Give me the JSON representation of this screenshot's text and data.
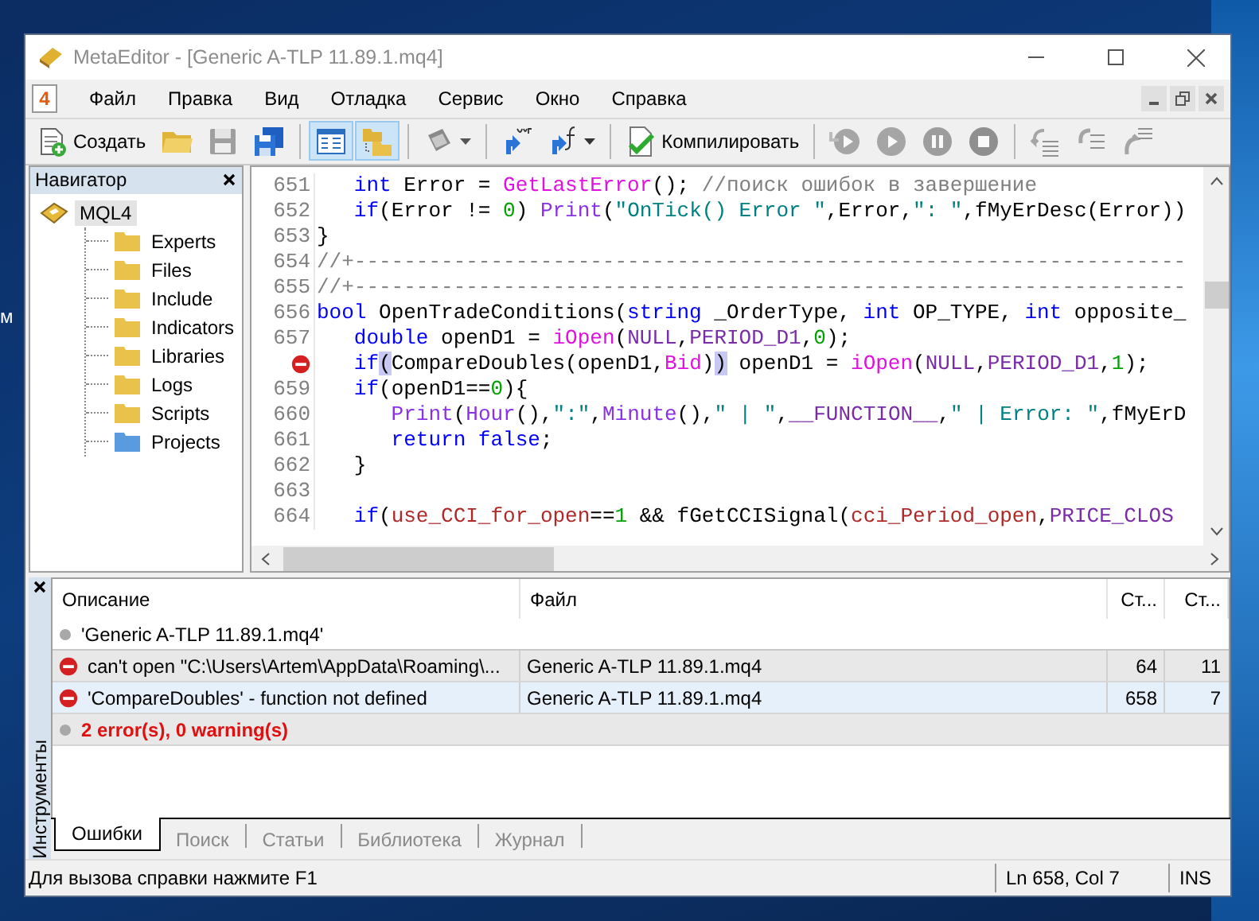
{
  "desktop": {
    "icon_label_fragment": "м"
  },
  "window": {
    "title": "MetaEditor - [Generic A-TLP 11.89.1.mq4]"
  },
  "menu": {
    "document_badge": "4",
    "items": [
      "Файл",
      "Правка",
      "Вид",
      "Отладка",
      "Сервис",
      "Окно",
      "Справка"
    ]
  },
  "toolbar": [
    {
      "label": "Создать",
      "on": false,
      "disabled": false
    },
    {
      "on": false,
      "disabled": false
    },
    {
      "on": false,
      "disabled": true
    },
    {
      "on": false,
      "disabled": false
    },
    {
      "on": true,
      "disabled": false
    },
    {
      "on": true,
      "disabled": false
    },
    {
      "on": false,
      "disabled": false
    },
    {
      "on": false,
      "disabled": false
    },
    {
      "on": false,
      "disabled": false
    },
    {
      "label": "Компилировать",
      "on": false,
      "disabled": false
    },
    {
      "on": false,
      "disabled": true
    },
    {
      "on": false,
      "disabled": true
    },
    {
      "on": false,
      "disabled": true
    },
    {
      "on": false,
      "disabled": true
    },
    {
      "on": false,
      "disabled": true
    },
    {
      "on": false,
      "disabled": true
    },
    {
      "on": false,
      "disabled": true
    }
  ],
  "navigator": {
    "title": "Навигатор",
    "root": {
      "label": "MQL4",
      "selected": true,
      "children": [
        {
          "label": "Experts",
          "selected": false,
          "color": "#e8c24a"
        },
        {
          "label": "Files",
          "selected": false,
          "color": "#e8c24a"
        },
        {
          "label": "Include",
          "selected": false,
          "color": "#e8c24a"
        },
        {
          "label": "Indicators",
          "selected": false,
          "color": "#e8c24a"
        },
        {
          "label": "Libraries",
          "selected": false,
          "color": "#e8c24a"
        },
        {
          "label": "Logs",
          "selected": false,
          "color": "#e8c24a"
        },
        {
          "label": "Scripts",
          "selected": false,
          "color": "#e8c24a"
        },
        {
          "label": "Projects",
          "selected": false,
          "color": "#5a9be0"
        }
      ]
    }
  },
  "editor": {
    "lines": [
      {
        "number": "651",
        "tokens": [
          {
            "kind": "keyword",
            "text": "   int"
          },
          {
            "kind": "plain",
            "text": " Error = "
          },
          {
            "kind": "function",
            "text": "GetLastError"
          },
          {
            "kind": "plain",
            "text": "(); "
          },
          {
            "kind": "comment",
            "text": "//поиск ошибок в завершение"
          }
        ]
      },
      {
        "number": "652",
        "tokens": [
          {
            "kind": "keyword",
            "text": "   if"
          },
          {
            "kind": "plain",
            "text": "(Error != "
          },
          {
            "kind": "number",
            "text": "0"
          },
          {
            "kind": "plain",
            "text": ") "
          },
          {
            "kind": "builtin",
            "text": "Print"
          },
          {
            "kind": "plain",
            "text": "("
          },
          {
            "kind": "string",
            "text": "\"OnTick() Error \""
          },
          {
            "kind": "plain",
            "text": ",Error,"
          },
          {
            "kind": "string",
            "text": "\": \""
          },
          {
            "kind": "plain",
            "text": ",fMyErDesc(Error))"
          }
        ]
      },
      {
        "number": "653",
        "tokens": [
          {
            "kind": "plain",
            "text": "}"
          }
        ]
      },
      {
        "number": "654",
        "tokens": [
          {
            "kind": "comment",
            "text": "//+-------------------------------------------------------------------"
          }
        ]
      },
      {
        "number": "655",
        "tokens": [
          {
            "kind": "comment",
            "text": "//+-------------------------------------------------------------------"
          }
        ]
      },
      {
        "number": "656",
        "tokens": [
          {
            "kind": "keyword",
            "text": "bool"
          },
          {
            "kind": "plain",
            "text": " OpenTradeConditions("
          },
          {
            "kind": "keyword",
            "text": "string"
          },
          {
            "kind": "plain",
            "text": " _OrderType, "
          },
          {
            "kind": "keyword",
            "text": "int"
          },
          {
            "kind": "plain",
            "text": " OP_TYPE, "
          },
          {
            "kind": "keyword",
            "text": "int"
          },
          {
            "kind": "plain",
            "text": " opposite_"
          }
        ]
      },
      {
        "number": "657",
        "tokens": [
          {
            "kind": "keyword",
            "text": "   double"
          },
          {
            "kind": "plain",
            "text": " openD1 = "
          },
          {
            "kind": "function",
            "text": "iOpen"
          },
          {
            "kind": "plain",
            "text": "("
          },
          {
            "kind": "constant",
            "text": "NULL"
          },
          {
            "kind": "plain",
            "text": ","
          },
          {
            "kind": "constant",
            "text": "PERIOD_D1"
          },
          {
            "kind": "plain",
            "text": ","
          },
          {
            "kind": "number",
            "text": "0"
          },
          {
            "kind": "plain",
            "text": ");"
          }
        ]
      },
      {
        "kind": "error",
        "tokens": [
          {
            "kind": "keyword",
            "text": "   if"
          },
          {
            "kind": "bracket",
            "text": "("
          },
          {
            "kind": "plain",
            "text": "CompareDoubles(openD1,"
          },
          {
            "kind": "function",
            "text": "Bid"
          },
          {
            "kind": "plain",
            "text": ")"
          },
          {
            "kind": "bracket",
            "text": ")"
          },
          {
            "kind": "plain",
            "text": " openD1 = "
          },
          {
            "kind": "function",
            "text": "iOpen"
          },
          {
            "kind": "plain",
            "text": "("
          },
          {
            "kind": "constant",
            "text": "NULL"
          },
          {
            "kind": "plain",
            "text": ","
          },
          {
            "kind": "constant",
            "text": "PERIOD_D1"
          },
          {
            "kind": "plain",
            "text": ","
          },
          {
            "kind": "number",
            "text": "1"
          },
          {
            "kind": "plain",
            "text": ");"
          }
        ]
      },
      {
        "number": "659",
        "tokens": [
          {
            "kind": "keyword",
            "text": "   if"
          },
          {
            "kind": "plain",
            "text": "(openD1=="
          },
          {
            "kind": "number",
            "text": "0"
          },
          {
            "kind": "plain",
            "text": "){"
          }
        ]
      },
      {
        "number": "660",
        "tokens": [
          {
            "kind": "builtin",
            "text": "      Print"
          },
          {
            "kind": "plain",
            "text": "("
          },
          {
            "kind": "builtin",
            "text": "Hour"
          },
          {
            "kind": "plain",
            "text": "(),"
          },
          {
            "kind": "string",
            "text": "\":\""
          },
          {
            "kind": "plain",
            "text": ","
          },
          {
            "kind": "builtin",
            "text": "Minute"
          },
          {
            "kind": "plain",
            "text": "(),"
          },
          {
            "kind": "string",
            "text": "\" | \""
          },
          {
            "kind": "plain",
            "text": ","
          },
          {
            "kind": "constant",
            "text": "__FUNCTION__"
          },
          {
            "kind": "plain",
            "text": ","
          },
          {
            "kind": "string",
            "text": "\" | Error: \""
          },
          {
            "kind": "plain",
            "text": ",fMyErD"
          }
        ]
      },
      {
        "number": "661",
        "tokens": [
          {
            "kind": "keyword",
            "text": "      return"
          },
          {
            "kind": "keyword",
            "text": " false"
          },
          {
            "kind": "plain",
            "text": ";"
          }
        ]
      },
      {
        "number": "662",
        "tokens": [
          {
            "kind": "plain",
            "text": "   }"
          }
        ]
      },
      {
        "number": "663"
      },
      {
        "number": "664",
        "tokens": [
          {
            "kind": "keyword",
            "text": "   if"
          },
          {
            "kind": "plain",
            "text": "("
          },
          {
            "kind": "input",
            "text": "use_CCI_for_open"
          },
          {
            "kind": "plain",
            "text": "=="
          },
          {
            "kind": "number",
            "text": "1"
          },
          {
            "kind": "plain",
            "text": " && fGetCCISignal("
          },
          {
            "kind": "input",
            "text": "cci_Period_open"
          },
          {
            "kind": "plain",
            "text": ","
          },
          {
            "kind": "constant",
            "text": "PRICE_CLOS"
          }
        ]
      }
    ]
  },
  "toolbox": {
    "title": "Инструменты",
    "columns": [
      "Описание",
      "Файл",
      "Ст...",
      "Ст..."
    ],
    "rows": [
      {
        "kind": "info",
        "description": "'Generic A-TLP 11.89.1.mq4'",
        "selected": false
      },
      {
        "kind": "error",
        "description": "can't open \"C:\\Users\\Artem\\AppData\\Roaming\\...",
        "file": "Generic A-TLP 11.89.1.mq4",
        "line": "64",
        "column": "11",
        "selected": false
      },
      {
        "kind": "error",
        "description": "'CompareDoubles' - function not defined",
        "file": "Generic A-TLP 11.89.1.mq4",
        "line": "658",
        "column": "7",
        "selected": true
      },
      {
        "kind": "summary",
        "description": "2 error(s), 0 warning(s)",
        "selected": false
      }
    ],
    "tabs": [
      {
        "label": "Ошибки",
        "selected": true
      },
      {
        "label": "Поиск",
        "selected": false
      },
      {
        "label": "Статьи",
        "selected": false
      },
      {
        "label": "Библиотека",
        "selected": false
      },
      {
        "label": "Журнал",
        "selected": false
      }
    ]
  },
  "status_bar": {
    "hint": "Для вызова справки нажмите F1",
    "position": "Ln 658, Col 7",
    "mode": "INS"
  }
}
